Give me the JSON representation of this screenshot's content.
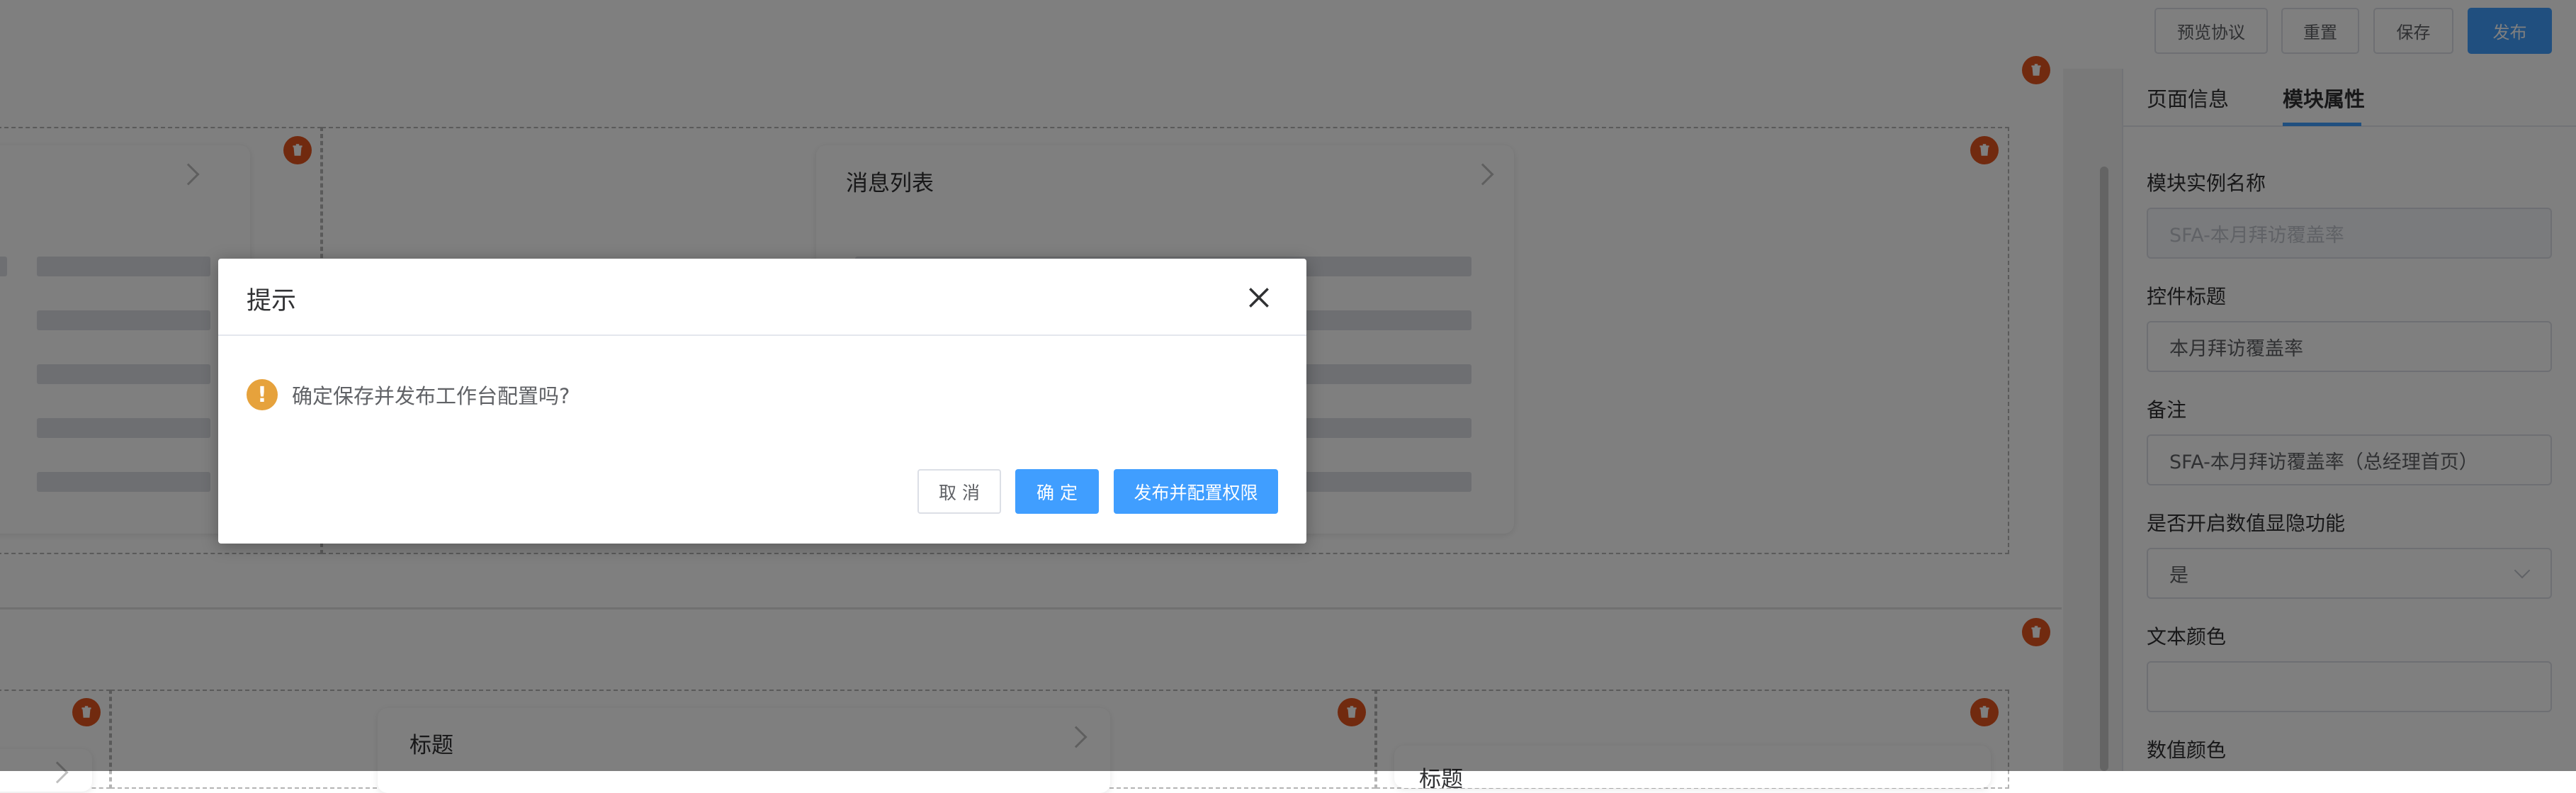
{
  "toolbar": {
    "preview_label": "预览协议",
    "reset_label": "重置",
    "save_label": "保存",
    "publish_label": "发布"
  },
  "canvas": {
    "cards": [
      {
        "title": ""
      },
      {
        "title": "消息列表"
      },
      {
        "title": "标题"
      },
      {
        "title": "标题"
      }
    ]
  },
  "panel": {
    "tabs": [
      {
        "label": "页面信息",
        "active": false
      },
      {
        "label": "模块属性",
        "active": true
      }
    ],
    "fields": [
      {
        "label": "模块实例名称",
        "value": "SFA-本月拜访覆盖率",
        "disabled": true
      },
      {
        "label": "控件标题",
        "value": "本月拜访覆盖率"
      },
      {
        "label": "备注",
        "value": "SFA-本月拜访覆盖率（总经理首页）"
      },
      {
        "label": "是否开启数值显隐功能",
        "value": "是",
        "type": "select"
      },
      {
        "label": "文本颜色",
        "value": ""
      },
      {
        "label": "数值颜色",
        "value": ""
      }
    ]
  },
  "dialog": {
    "title": "提示",
    "message": "确定保存并发布工作台配置吗?",
    "cancel_label": "取 消",
    "confirm_label": "确 定",
    "publish_config_label": "发布并配置权限"
  },
  "colors": {
    "primary": "#409eff",
    "warning": "#e6a23c",
    "delete": "#e2541f"
  }
}
